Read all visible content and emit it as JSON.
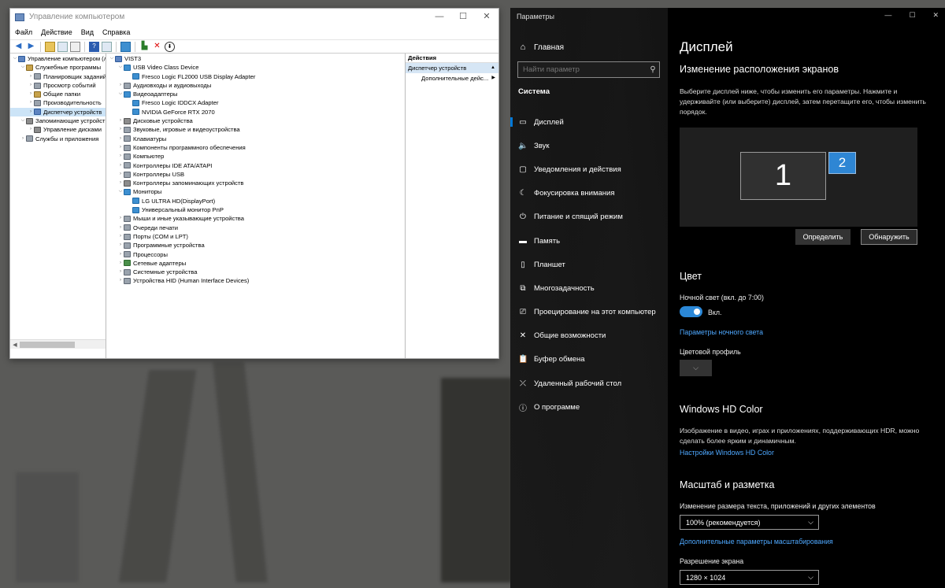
{
  "computer_management": {
    "title": "Управление компьютером",
    "menu": [
      "Файл",
      "Действие",
      "Вид",
      "Справка"
    ],
    "tree": [
      {
        "label": "Управление компьютером (лс",
        "level": 0,
        "icon": "computer-icon"
      },
      {
        "label": "Служебные программы",
        "level": 1,
        "icon": "tools-icon"
      },
      {
        "label": "Планировщик заданий",
        "level": 2,
        "icon": "clock-icon"
      },
      {
        "label": "Просмотр событий",
        "level": 2,
        "icon": "event-viewer-icon"
      },
      {
        "label": "Общие папки",
        "level": 2,
        "icon": "shared-folder-icon"
      },
      {
        "label": "Производительность",
        "level": 2,
        "icon": "performance-icon"
      },
      {
        "label": "Диспетчер устройств",
        "level": 2,
        "icon": "device-manager-icon",
        "selected": true
      },
      {
        "label": "Запоминающие устройств",
        "level": 1,
        "icon": "storage-icon"
      },
      {
        "label": "Управление дисками",
        "level": 2,
        "icon": "disk-icon"
      },
      {
        "label": "Службы и приложения",
        "level": 1,
        "icon": "services-icon"
      }
    ],
    "devices": [
      {
        "label": "VIST3",
        "level": 0,
        "expanded": true
      },
      {
        "label": "USB Video Class Device",
        "level": 1,
        "expanded": true
      },
      {
        "label": "Fresco Logic FL2000 USB Display Adapter",
        "level": 2
      },
      {
        "label": "Аудиовходы и аудиовыходы",
        "level": 1
      },
      {
        "label": "Видеоадаптеры",
        "level": 1,
        "expanded": true
      },
      {
        "label": "Fresco Logic IDDCX Adapter",
        "level": 2
      },
      {
        "label": "NVIDIA GeForce RTX 2070",
        "level": 2
      },
      {
        "label": "Дисковые устройства",
        "level": 1
      },
      {
        "label": "Звуковые, игровые и видеоустройства",
        "level": 1
      },
      {
        "label": "Клавиатуры",
        "level": 1
      },
      {
        "label": "Компоненты программного обеспечения",
        "level": 1
      },
      {
        "label": "Компьютер",
        "level": 1
      },
      {
        "label": "Контроллеры IDE ATA/ATAPI",
        "level": 1
      },
      {
        "label": "Контроллеры USB",
        "level": 1
      },
      {
        "label": "Контроллеры запоминающих устройств",
        "level": 1
      },
      {
        "label": "Мониторы",
        "level": 1,
        "expanded": true
      },
      {
        "label": "LG ULTRA HD(DisplayPort)",
        "level": 2
      },
      {
        "label": "Универсальный монитор PnP",
        "level": 2
      },
      {
        "label": "Мыши и иные указывающие устройства",
        "level": 1
      },
      {
        "label": "Очереди печати",
        "level": 1
      },
      {
        "label": "Порты (COM и LPT)",
        "level": 1
      },
      {
        "label": "Программные устройства",
        "level": 1
      },
      {
        "label": "Процессоры",
        "level": 1
      },
      {
        "label": "Сетевые адаптеры",
        "level": 1
      },
      {
        "label": "Системные устройства",
        "level": 1
      },
      {
        "label": "Устройства HID (Human Interface Devices)",
        "level": 1
      }
    ],
    "actions": {
      "header": "Действия",
      "items": [
        {
          "label": "Диспетчер устройств",
          "highlight": true,
          "arrow": "▲"
        },
        {
          "label": "Дополнительные дейс...",
          "highlight": false,
          "arrow": "▶"
        }
      ]
    }
  },
  "settings": {
    "app_title": "Параметры",
    "home": "Главная",
    "search_placeholder": "Найти параметр",
    "section": "Система",
    "nav": [
      {
        "label": "Дисплей",
        "icon": "display-icon",
        "glyph": "▭",
        "active": true
      },
      {
        "label": "Звук",
        "icon": "sound-icon",
        "glyph": "🔈"
      },
      {
        "label": "Уведомления и действия",
        "icon": "notifications-icon",
        "glyph": "▢"
      },
      {
        "label": "Фокусировка внимания",
        "icon": "focus-assist-icon",
        "glyph": "☾"
      },
      {
        "label": "Питание и спящий режим",
        "icon": "power-icon",
        "glyph": "⏻"
      },
      {
        "label": "Память",
        "icon": "storage-icon",
        "glyph": "▬"
      },
      {
        "label": "Планшет",
        "icon": "tablet-icon",
        "glyph": "▯"
      },
      {
        "label": "Многозадачность",
        "icon": "multitasking-icon",
        "glyph": "⧉"
      },
      {
        "label": "Проецирование на этот компьютер",
        "icon": "projecting-icon",
        "glyph": "⎚"
      },
      {
        "label": "Общие возможности",
        "icon": "shared-experiences-icon",
        "glyph": "✕"
      },
      {
        "label": "Буфер обмена",
        "icon": "clipboard-icon",
        "glyph": "📋"
      },
      {
        "label": "Удаленный рабочий стол",
        "icon": "remote-desktop-icon",
        "glyph": "⤫"
      },
      {
        "label": "О программе",
        "icon": "about-icon",
        "glyph": "ⓘ"
      }
    ],
    "page": {
      "title": "Дисплей",
      "arrange_heading": "Изменение расположения экранов",
      "arrange_text": "Выберите дисплей ниже, чтобы изменить его параметры. Нажмите и удерживайте (или выберите) дисплей, затем перетащите его, чтобы изменить порядок.",
      "monitor1": "1",
      "monitor2": "2",
      "identify_button": "Определить",
      "detect_button": "Обнаружить",
      "color_heading": "Цвет",
      "night_light_label": "Ночной свет (вкл. до 7:00)",
      "night_light_state": "Вкл.",
      "night_light_link": "Параметры ночного света",
      "color_profile_label": "Цветовой профиль",
      "hdr_heading": "Windows HD Color",
      "hdr_text": "Изображение в видео, играх и приложениях, поддерживающих HDR, можно сделать более ярким и динамичным.",
      "hdr_link": "Настройки Windows HD Color",
      "scale_heading": "Масштаб и разметка",
      "scale_label": "Изменение размера текста, приложений и других элементов",
      "scale_value": "100% (рекомендуется)",
      "scale_link": "Дополнительные параметры масштабирования",
      "resolution_label": "Разрешение экрана",
      "resolution_value": "1280 × 1024"
    }
  }
}
